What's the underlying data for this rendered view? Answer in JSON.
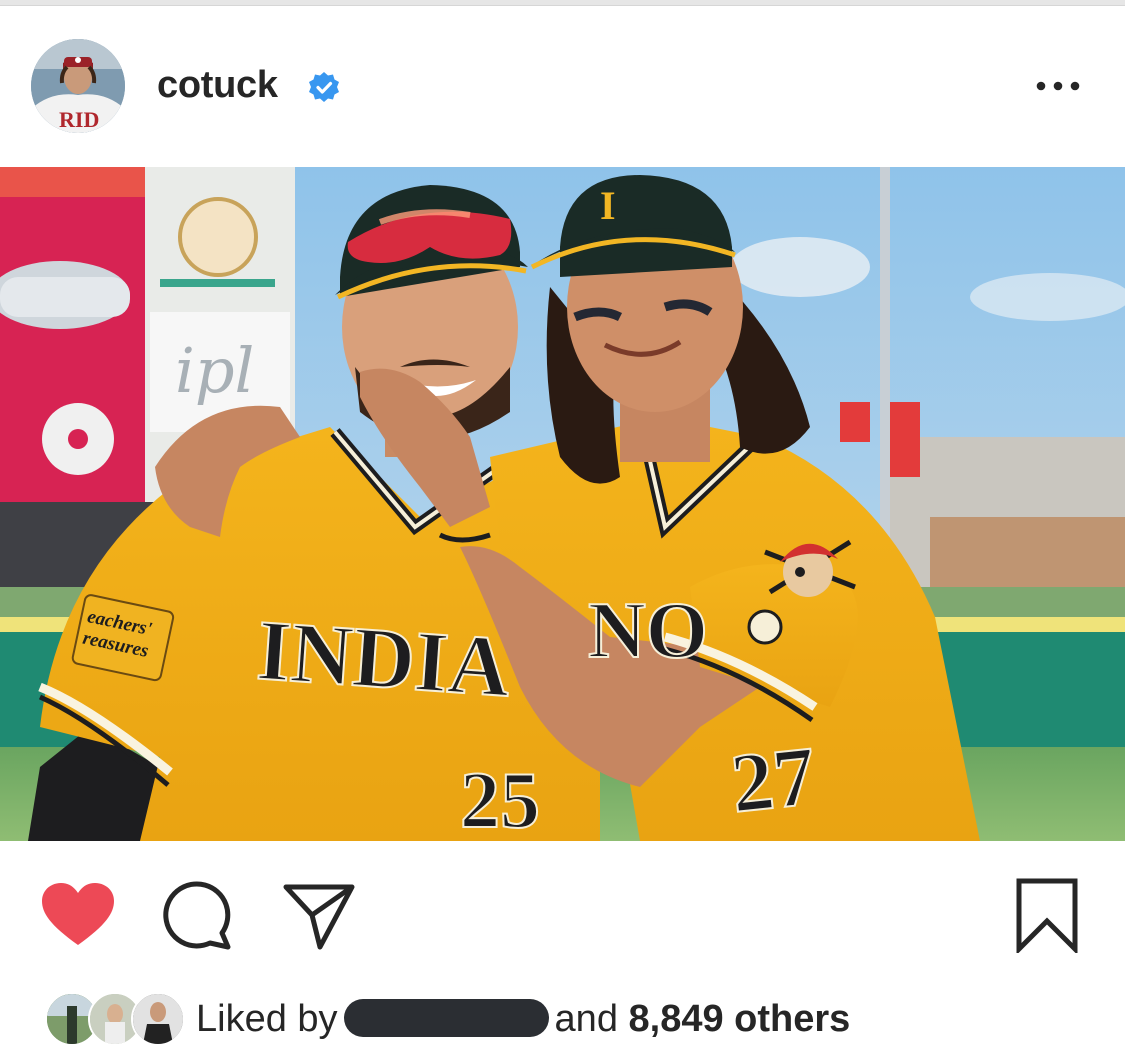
{
  "post": {
    "username": "cotuck",
    "verified": true,
    "more_icon": "more-horizontal-icon"
  },
  "photo": {
    "jersey_text": "INDIA",
    "jersey_text_right": "NO",
    "number_left": "25",
    "number_right": "27",
    "sleeve_patch_line1": "eachers'",
    "sleeve_patch_line2": "reasures",
    "banner_text": "ipl"
  },
  "actions": {
    "like_icon": "heart-filled-icon",
    "comment_icon": "comment-icon",
    "share_icon": "paper-plane-icon",
    "save_icon": "bookmark-icon",
    "like_color": "#ed4956"
  },
  "likes": {
    "prefix": "Liked by",
    "conjunction": "and",
    "count": "8,849 others"
  }
}
